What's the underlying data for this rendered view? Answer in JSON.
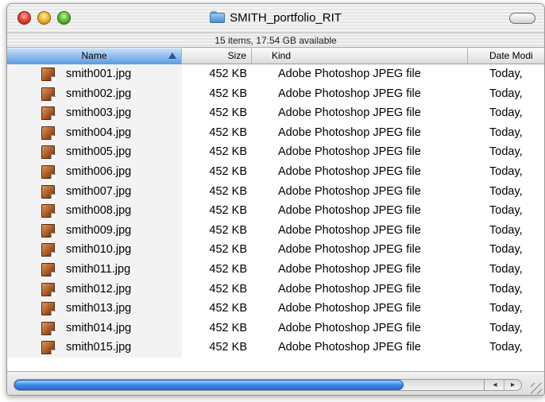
{
  "window": {
    "title": "SMITH_portfolio_RIT",
    "status": "15 items, 17.54 GB available"
  },
  "columns": {
    "name": "Name",
    "size": "Size",
    "kind": "Kind",
    "date": "Date Modi"
  },
  "files": [
    {
      "name": "smith001.jpg",
      "size": "452 KB",
      "kind": "Adobe Photoshop JPEG file",
      "date": "Today,"
    },
    {
      "name": "smith002.jpg",
      "size": "452 KB",
      "kind": "Adobe Photoshop JPEG file",
      "date": "Today,"
    },
    {
      "name": "smith003.jpg",
      "size": "452 KB",
      "kind": "Adobe Photoshop JPEG file",
      "date": "Today,"
    },
    {
      "name": "smith004.jpg",
      "size": "452 KB",
      "kind": "Adobe Photoshop JPEG file",
      "date": "Today,"
    },
    {
      "name": "smith005.jpg",
      "size": "452 KB",
      "kind": "Adobe Photoshop JPEG file",
      "date": "Today,"
    },
    {
      "name": "smith006.jpg",
      "size": "452 KB",
      "kind": "Adobe Photoshop JPEG file",
      "date": "Today,"
    },
    {
      "name": "smith007.jpg",
      "size": "452 KB",
      "kind": "Adobe Photoshop JPEG file",
      "date": "Today,"
    },
    {
      "name": "smith008.jpg",
      "size": "452 KB",
      "kind": "Adobe Photoshop JPEG file",
      "date": "Today,"
    },
    {
      "name": "smith009.jpg",
      "size": "452 KB",
      "kind": "Adobe Photoshop JPEG file",
      "date": "Today,"
    },
    {
      "name": "smith010.jpg",
      "size": "452 KB",
      "kind": "Adobe Photoshop JPEG file",
      "date": "Today,"
    },
    {
      "name": "smith011.jpg",
      "size": "452 KB",
      "kind": "Adobe Photoshop JPEG file",
      "date": "Today,"
    },
    {
      "name": "smith012.jpg",
      "size": "452 KB",
      "kind": "Adobe Photoshop JPEG file",
      "date": "Today,"
    },
    {
      "name": "smith013.jpg",
      "size": "452 KB",
      "kind": "Adobe Photoshop JPEG file",
      "date": "Today,"
    },
    {
      "name": "smith014.jpg",
      "size": "452 KB",
      "kind": "Adobe Photoshop JPEG file",
      "date": "Today,"
    },
    {
      "name": "smith015.jpg",
      "size": "452 KB",
      "kind": "Adobe Photoshop JPEG file",
      "date": "Today,"
    }
  ],
  "icons": {
    "close": "close-button-icon",
    "minimize": "minimize-button-icon",
    "zoom": "zoom-button-icon",
    "folder": "folder-icon",
    "file": "jpeg-file-icon",
    "sort": "sort-ascending-icon",
    "scroll_left": "◂",
    "scroll_right": "▸"
  },
  "colors": {
    "selected_header": "#5a9ae0",
    "scroll_thumb": "#3d8ae8",
    "file_icon": "#a85a28"
  }
}
